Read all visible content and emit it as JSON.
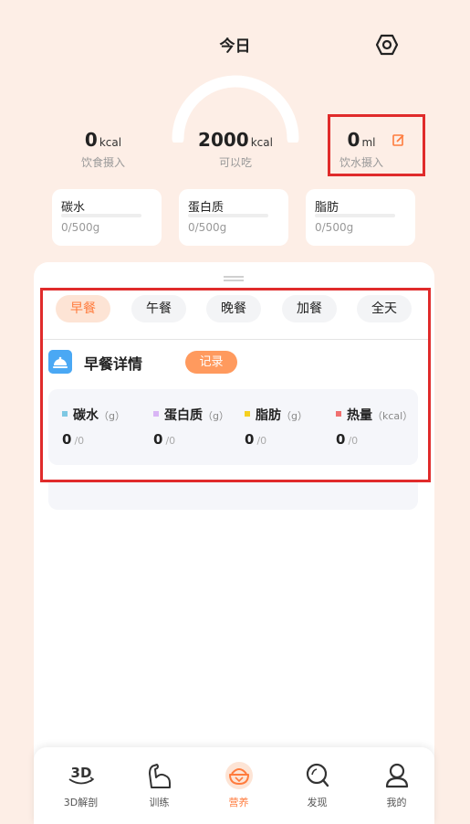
{
  "header": {
    "title": "今日"
  },
  "summary": {
    "intake": {
      "value": "0",
      "unit": "kcal",
      "label": "饮食摄入"
    },
    "remaining": {
      "value": "2000",
      "unit": "kcal",
      "label": "可以吃"
    },
    "water": {
      "value": "0",
      "unit": "ml",
      "label": "饮水摄入"
    }
  },
  "macros": [
    {
      "name": "碳水",
      "value": "0/500g"
    },
    {
      "name": "蛋白质",
      "value": "0/500g"
    },
    {
      "name": "脂肪",
      "value": "0/500g"
    }
  ],
  "meal_tabs": [
    "早餐",
    "午餐",
    "晚餐",
    "加餐",
    "全天"
  ],
  "selected_tab": "早餐",
  "meal_detail": {
    "title": "早餐详情",
    "record_label": "记录",
    "nutrients": [
      {
        "name": "碳水",
        "unit": "（g）",
        "value": "0",
        "denom": "/0",
        "color": "#7ec8e3"
      },
      {
        "name": "蛋白质",
        "unit": "（g）",
        "value": "0",
        "denom": "/0",
        "color": "#d9b5f5"
      },
      {
        "name": "脂肪",
        "unit": "（g）",
        "value": "0",
        "denom": "/0",
        "color": "#f5d020"
      },
      {
        "name": "热量",
        "unit": "（kcal）",
        "value": "0",
        "denom": "/0",
        "color": "#f07070"
      }
    ]
  },
  "bottom_nav": [
    {
      "label": "3D解剖",
      "icon": "3d-anatomy-icon"
    },
    {
      "label": "训练",
      "icon": "flexed-arm-icon"
    },
    {
      "label": "营养",
      "icon": "food-bowl-icon",
      "active": true
    },
    {
      "label": "发现",
      "icon": "discover-search-icon"
    },
    {
      "label": "我的",
      "icon": "user-profile-icon"
    }
  ],
  "colors": {
    "accent": "#ff7b3d",
    "background": "#fdeee6",
    "highlight_box": "#e02b2b"
  }
}
